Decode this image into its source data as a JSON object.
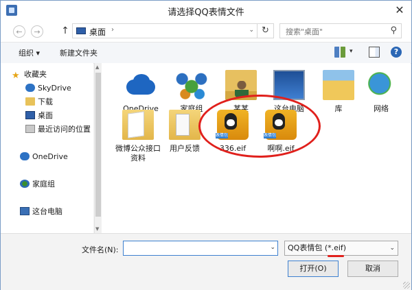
{
  "window": {
    "title": "请选择QQ表情文件",
    "close_glyph": "✕"
  },
  "nav": {
    "back_glyph": "←",
    "forward_glyph": "→",
    "up_glyph": "↑",
    "address": {
      "crumb": "桌面",
      "separator": "›",
      "dropdown_glyph": "⌄"
    },
    "refresh_glyph": "↻",
    "search": {
      "placeholder": "搜索\"桌面\"",
      "icon": "search-icon",
      "glyph": "⚲"
    }
  },
  "toolbar": {
    "organize_label": "组织 ▾",
    "new_folder_label": "新建文件夹",
    "view_dropdown_glyph": "▾",
    "help_glyph": "?"
  },
  "sidebar": {
    "items": [
      {
        "label": "收藏夹",
        "icon": "star-icon"
      },
      {
        "label": "SkyDrive",
        "icon": "cloud-icon"
      },
      {
        "label": "下载",
        "icon": "folder-icon"
      },
      {
        "label": "桌面",
        "icon": "desktop-icon"
      },
      {
        "label": "最近访问的位置",
        "icon": "recent-icon"
      },
      {
        "label": "OneDrive",
        "icon": "cloud-icon"
      },
      {
        "label": "家庭组",
        "icon": "homegroup-icon"
      },
      {
        "label": "这台电脑",
        "icon": "computer-icon"
      }
    ]
  },
  "content": {
    "tiles": [
      {
        "label": "OneDrive",
        "icon": "onedrive-icon"
      },
      {
        "label": "家庭组",
        "icon": "homegroup-icon"
      },
      {
        "label": "某某",
        "icon": "user-folder-icon"
      },
      {
        "label": "这台电脑",
        "icon": "this-pc-icon"
      },
      {
        "label": "库",
        "icon": "libraries-icon"
      },
      {
        "label": "网络",
        "icon": "network-icon"
      },
      {
        "label": "微博公众接口资料",
        "icon": "folder-icon"
      },
      {
        "label": "用户反馈",
        "icon": "folder-icon"
      },
      {
        "label": "336.eif",
        "icon": "qq-eif-icon"
      },
      {
        "label": "啊啊.eif",
        "icon": "qq-eif-icon"
      }
    ],
    "eif_badge": "表情包"
  },
  "bottom": {
    "filename_label": "文件名(N):",
    "filename_value": "",
    "filter_value": "QQ表情包 (*.eif)",
    "dropdown_glyph": "⌄",
    "open_label": "打开(O)",
    "cancel_label": "取消"
  },
  "colors": {
    "accent": "#3c7fcf",
    "annotation_red": "#e0201c"
  }
}
